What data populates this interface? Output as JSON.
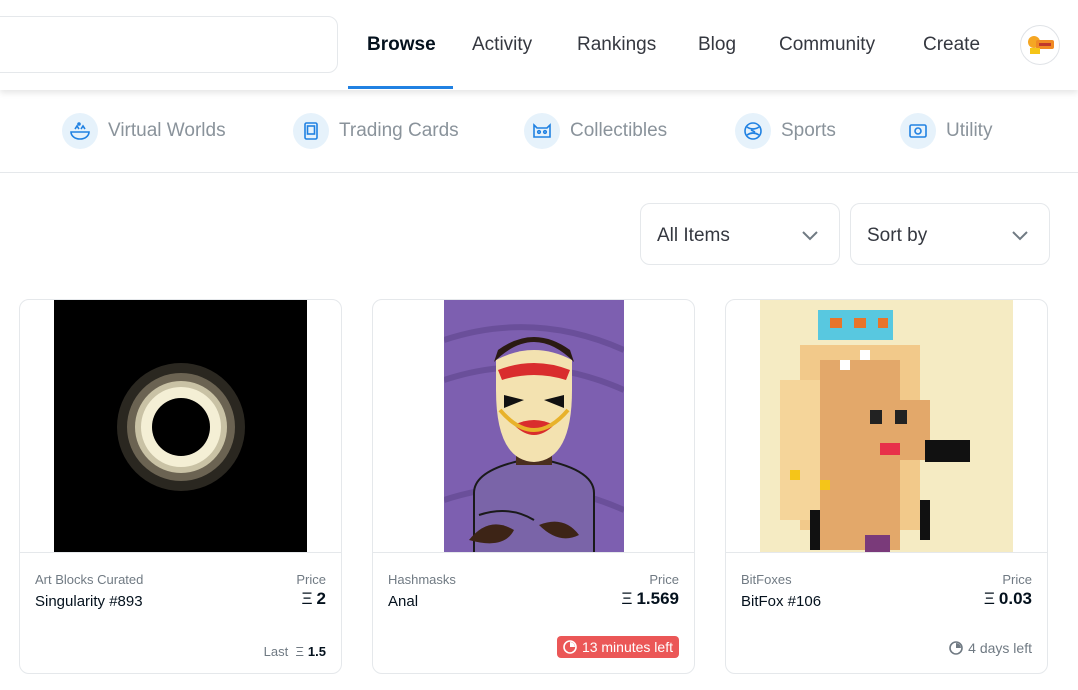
{
  "nav": {
    "links": [
      {
        "label": "Browse",
        "active": true
      },
      {
        "label": "Activity"
      },
      {
        "label": "Rankings"
      },
      {
        "label": "Blog"
      },
      {
        "label": "Community"
      },
      {
        "label": "Create"
      }
    ],
    "accent": "#2081e2"
  },
  "categories": [
    {
      "label": "Virtual Worlds",
      "icon": "virtual-worlds-icon"
    },
    {
      "label": "Trading Cards",
      "icon": "trading-cards-icon"
    },
    {
      "label": "Collectibles",
      "icon": "collectibles-icon"
    },
    {
      "label": "Sports",
      "icon": "sports-icon"
    },
    {
      "label": "Utility",
      "icon": "utility-icon"
    }
  ],
  "filters": {
    "items_label": "All Items",
    "sort_label": "Sort by"
  },
  "cards": [
    {
      "collection": "Art Blocks Curated",
      "name": "Singularity #893",
      "price_label": "Price",
      "eth_symbol": "Ξ",
      "price": "2",
      "last_label": "Last",
      "last_price": "1.5"
    },
    {
      "collection": "Hashmasks",
      "name": "Anal",
      "price_label": "Price",
      "eth_symbol": "Ξ",
      "price": "1.569",
      "time_left": "13 minutes left",
      "urgent_color": "#eb5757"
    },
    {
      "collection": "BitFoxes",
      "name": "BitFox #106",
      "price_label": "Price",
      "eth_symbol": "Ξ",
      "price": "0.03",
      "time_left": "4 days left"
    }
  ]
}
